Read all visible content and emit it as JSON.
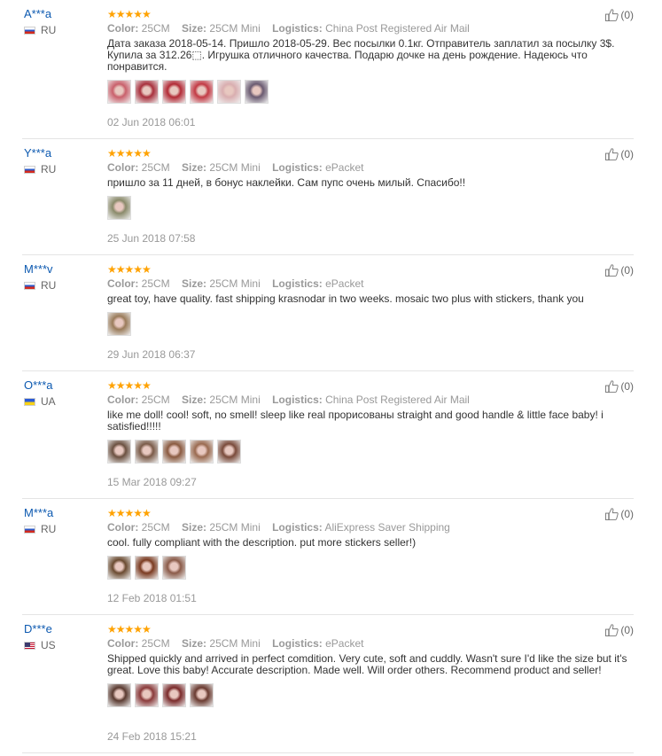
{
  "reviews": [
    {
      "user": "A***a",
      "country": "RU",
      "color_label": "Color:",
      "color": "25CM",
      "size_label": "Size:",
      "size": "25CM Mini",
      "logistics_label": "Logistics:",
      "logistics": "China Post Registered Air Mail",
      "text": "Дата заказа 2018-05-14. Пришло 2018-05-29. Вес посылки 0.1кг. Отправитель заплатил за посылку 3$. Купила за 312.26⬚. Игрушка отличного качества. Подарю дочке на день рождение. Надеюсь что понравится.",
      "photo_colors": [
        "#c9606b",
        "#a8303c",
        "#b22a35",
        "#c23a44",
        "#d9aeb0",
        "#6a5a70"
      ],
      "date": "02 Jun 2018 06:01",
      "helpful": "(0)"
    },
    {
      "user": "Y***a",
      "country": "RU",
      "color_label": "Color:",
      "color": "25CM",
      "size_label": "Size:",
      "size": "25CM Mini",
      "logistics_label": "Logistics:",
      "logistics": "ePacket",
      "text": "пришло за 11 дней, в бонус наклейки. Сам пупс очень милый. Спасибо!!",
      "photo_colors": [
        "#8a8a6a"
      ],
      "date": "25 Jun 2018 07:58",
      "helpful": "(0)"
    },
    {
      "user": "M***v",
      "country": "RU",
      "color_label": "Color:",
      "color": "25CM",
      "size_label": "Size:",
      "size": "25CM Mini",
      "logistics_label": "Logistics:",
      "logistics": "ePacket",
      "text": "great toy, have quality. fast shipping krasnodar in two weeks. mosaic two plus with stickers, thank you",
      "photo_colors": [
        "#9a7b5a"
      ],
      "date": "29 Jun 2018 06:37",
      "helpful": "(0)"
    },
    {
      "user": "O***a",
      "country": "UA",
      "color_label": "Color:",
      "color": "25CM",
      "size_label": "Size:",
      "size": "25CM Mini",
      "logistics_label": "Logistics:",
      "logistics": "China Post Registered Air Mail",
      "text": "like me doll! cool! soft, no smell! sleep like real прорисованы straight and good handle & little face baby! i satisfied!!!!!",
      "photo_colors": [
        "#6b5040",
        "#7a5a48",
        "#8a5a40",
        "#9a6a50",
        "#7a4a3a"
      ],
      "date": "15 Mar 2018 09:27",
      "helpful": "(0)"
    },
    {
      "user": "M***a",
      "country": "RU",
      "color_label": "Color:",
      "color": "25CM",
      "size_label": "Size:",
      "size": "25CM Mini",
      "logistics_label": "Logistics:",
      "logistics": "AliExpress Saver Shipping",
      "text": "cool. fully compliant with the description. put more stickers seller!)",
      "photo_colors": [
        "#6a4a30",
        "#7a3a20",
        "#8a5a48"
      ],
      "date": "12 Feb 2018 01:51",
      "helpful": "(0)"
    },
    {
      "user": "D***e",
      "country": "US",
      "color_label": "Color:",
      "color": "25CM",
      "size_label": "Size:",
      "size": "25CM Mini",
      "logistics_label": "Logistics:",
      "logistics": "ePacket",
      "text": "Shipped quickly and arrived in perfect comdition. Very cute, soft and cuddly. Wasn't sure I'd like the size but it's great. Love this baby! Accurate description. Made well. Will order others. Recommend product and seller!",
      "photo_colors": [
        "#5a3a30",
        "#8a3a3a",
        "#7a2a2a",
        "#6a3a30"
      ],
      "date": "24 Feb 2018 15:21",
      "helpful": "(0)"
    }
  ],
  "stars": "★★★★★",
  "colors": {
    "username": "#0c59b0",
    "stars": "#ffa200",
    "muted": "#999999"
  }
}
